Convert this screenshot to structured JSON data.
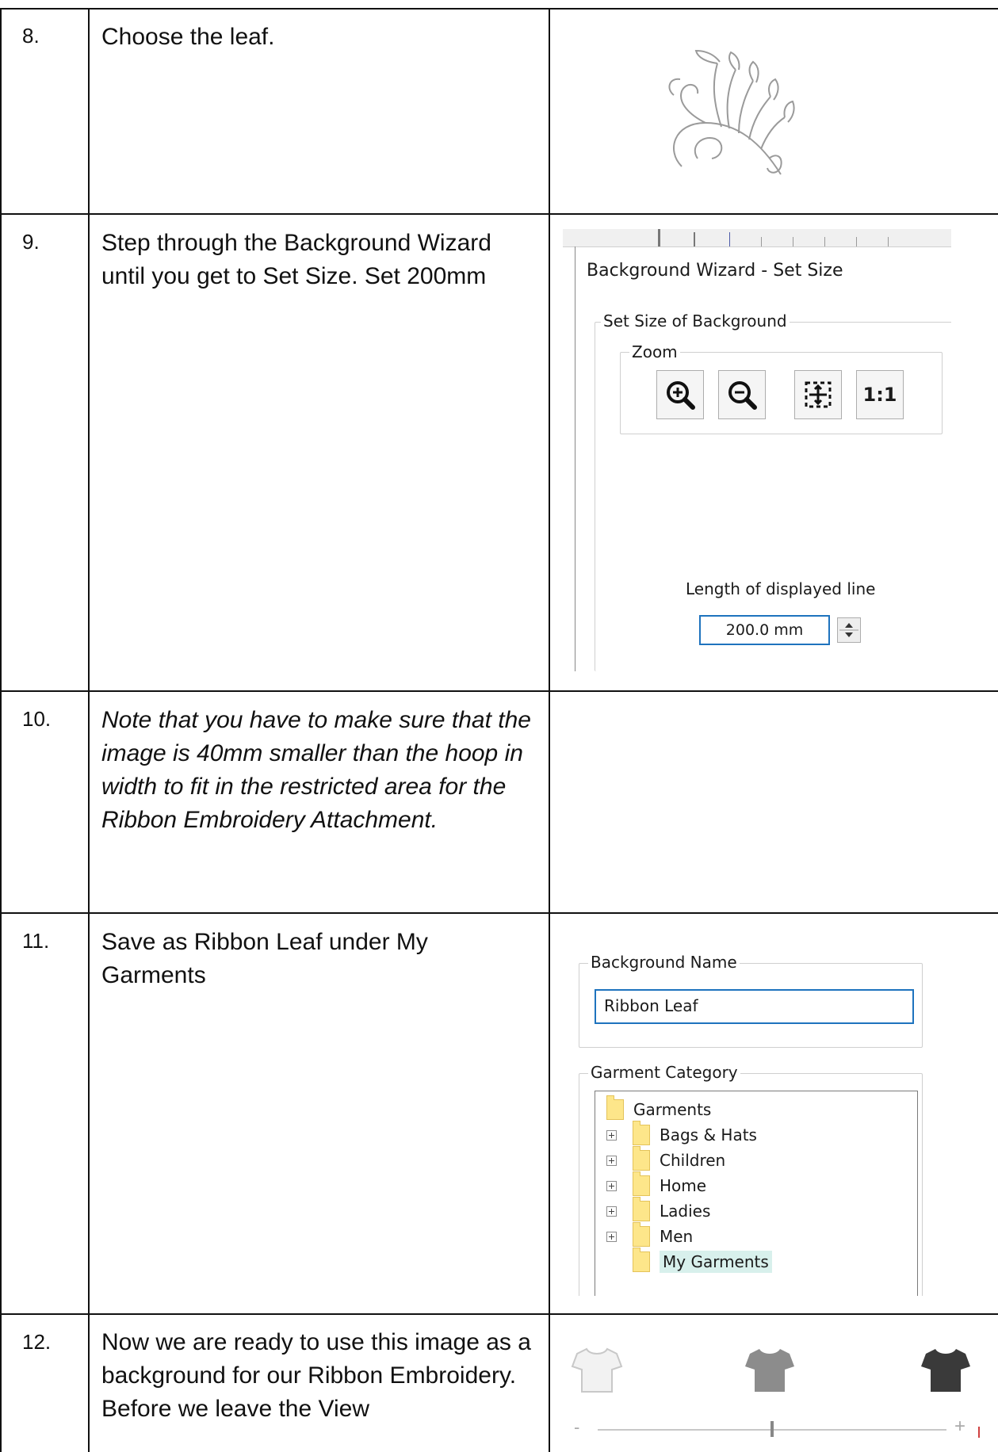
{
  "rows": [
    {
      "number": "8.",
      "text": "Choose the leaf."
    },
    {
      "number": "9.",
      "text": "Step through the Background Wizard until you get to Set Size. Set 200mm",
      "screenshot": {
        "dialog_title": "Background Wizard - Set Size",
        "group_title": "Set Size of Background",
        "zoom_label": "Zoom",
        "zoom_buttons": [
          {
            "icon": "zoom-in-icon"
          },
          {
            "icon": "zoom-out-icon"
          },
          {
            "icon": "zoom-fit-icon"
          },
          {
            "icon": "zoom-actual-size",
            "label": "1:1"
          }
        ],
        "length_label": "Length of displayed line",
        "length_value": "200.0 mm"
      }
    },
    {
      "number": "10.",
      "text": "Note that you have to make sure that the image is 40mm smaller than the hoop in width to fit in the restricted area for the Ribbon Embroidery Attachment."
    },
    {
      "number": "11.",
      "text": "Save as Ribbon Leaf under My Garments",
      "screenshot": {
        "name_group_label": "Background Name",
        "name_value": "Ribbon Leaf",
        "category_group_label": "Garment Category",
        "tree_root": "Garments",
        "tree_items": [
          "Bags & Hats",
          "Children",
          "Home",
          "Ladies",
          "Men",
          "My Garments"
        ],
        "selected_item": "My Garments"
      }
    },
    {
      "number": "12.",
      "text": "Now we are ready to use this image as a background for our Ribbon Embroidery. Before we leave the View",
      "screenshot": {
        "slider_icons": [
          "shirt-light-icon",
          "shirt-medium-icon",
          "shirt-dark-icon"
        ],
        "slider_min_label": "-",
        "slider_max_label": "+",
        "slider_level": 0.5
      }
    }
  ],
  "colors": {
    "folder": "#fde68a",
    "selection": "#d8f0ec",
    "input_border": "#1e73be",
    "shirt_light": "#f2f2f2",
    "shirt_medium": "#8c8c8c",
    "shirt_dark": "#3a3a3a"
  }
}
